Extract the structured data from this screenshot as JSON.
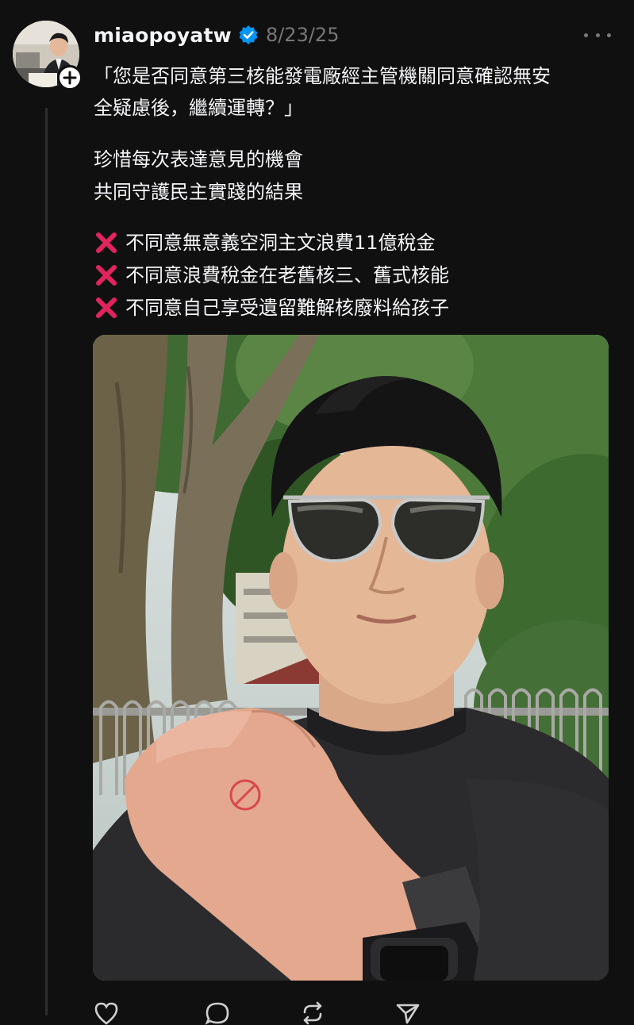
{
  "post": {
    "username": "miaopoyatw",
    "timestamp": "8/23/25",
    "lines": [
      "「您是否同意第三核能發電廠經主管機關同意確認無安",
      "全疑慮後，繼續運轉？」",
      "珍惜每次表達意見的機會",
      "共同守護民主實踐的結果"
    ],
    "disagree_items": [
      "不同意無意義空洞主文浪費11億稅金",
      "不同意浪費稅金在老舊核三、舊式核能",
      "不同意自己享受遺留難解核廢料給孩子"
    ]
  },
  "actions": {
    "like_count": "",
    "reply_count": "",
    "repost_count": "",
    "share_count": ""
  },
  "icons": {
    "avatar": "profile-photo",
    "follow": "plus-icon",
    "verified": "verified-badge-icon",
    "more": "more-icon",
    "bullet": "cross-mark-icon",
    "like": "heart-icon",
    "reply": "comment-icon",
    "repost": "repost-icon",
    "share": "send-icon"
  },
  "colors": {
    "background": "#101010",
    "text": "#f3f5f7",
    "muted": "#777777",
    "verified": "#0095f6",
    "cross": "#e0245e"
  }
}
